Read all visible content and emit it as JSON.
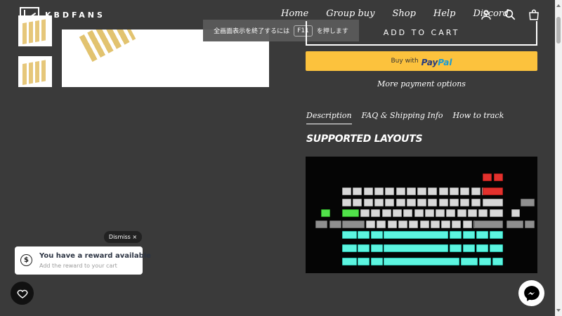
{
  "header": {
    "logo_text": "KBDFANS",
    "nav": [
      "Home",
      "Group buy",
      "Shop",
      "Help",
      "Discord"
    ],
    "icons": [
      "account-icon",
      "search-icon",
      "cart-icon"
    ]
  },
  "fullscreen_toast": {
    "text_before": "全画面表示を終了するには",
    "key": "F11",
    "text_after": "を押します"
  },
  "product": {
    "add_to_cart": "ADD TO CART",
    "paypal_prefix": "Buy with",
    "paypal_brand_1": "Pay",
    "paypal_brand_2": "Pal",
    "more_payment": "More payment options"
  },
  "tabs": [
    {
      "label": "Description",
      "active": true
    },
    {
      "label": "FAQ & Shipping Info",
      "active": false
    },
    {
      "label": "How to track",
      "active": false
    }
  ],
  "section_title": "SUPPORTED LAYOUTS",
  "reward": {
    "dismiss": "Dismiss ×",
    "icon": "$",
    "title": "You have a reward available",
    "subtitle": "Add the reward to your cart"
  },
  "colors": {
    "background": "#3a3a3a",
    "paypal_yellow": "#fcc23d",
    "key_cyan": "#5cf5e0",
    "key_red": "#e3312d",
    "key_green": "#51e24a"
  }
}
